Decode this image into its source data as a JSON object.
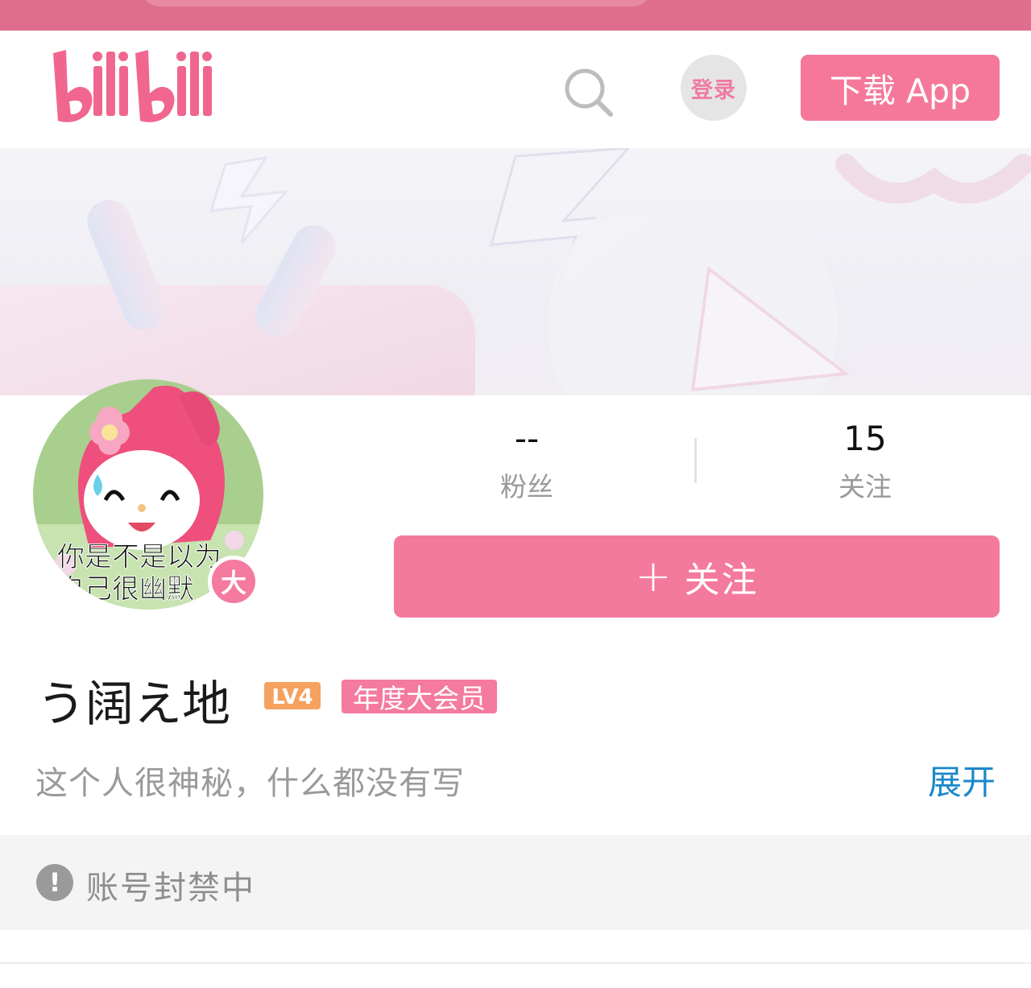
{
  "header": {
    "logo_text": "bilibili",
    "login_label": "登录",
    "download_label": "下载 App"
  },
  "profile": {
    "avatar_caption_line1": "你是不是以为",
    "avatar_caption_line2": "自己很幽默",
    "vip_badge": "大",
    "fans_count": "--",
    "fans_label": "粉丝",
    "following_count": "15",
    "following_label": "关注",
    "follow_button_label": "关注",
    "username": "う阔え地",
    "level": "LV4",
    "vip_tag": "年度大会员",
    "signature": "这个人很神秘，什么都没有写",
    "expand_label": "展开"
  },
  "notice": {
    "icon": "!",
    "text": "账号封禁中"
  },
  "colors": {
    "brand_pink": "#f47a9d",
    "link_blue": "#1a88c9",
    "level_orange": "#f5a15f"
  }
}
